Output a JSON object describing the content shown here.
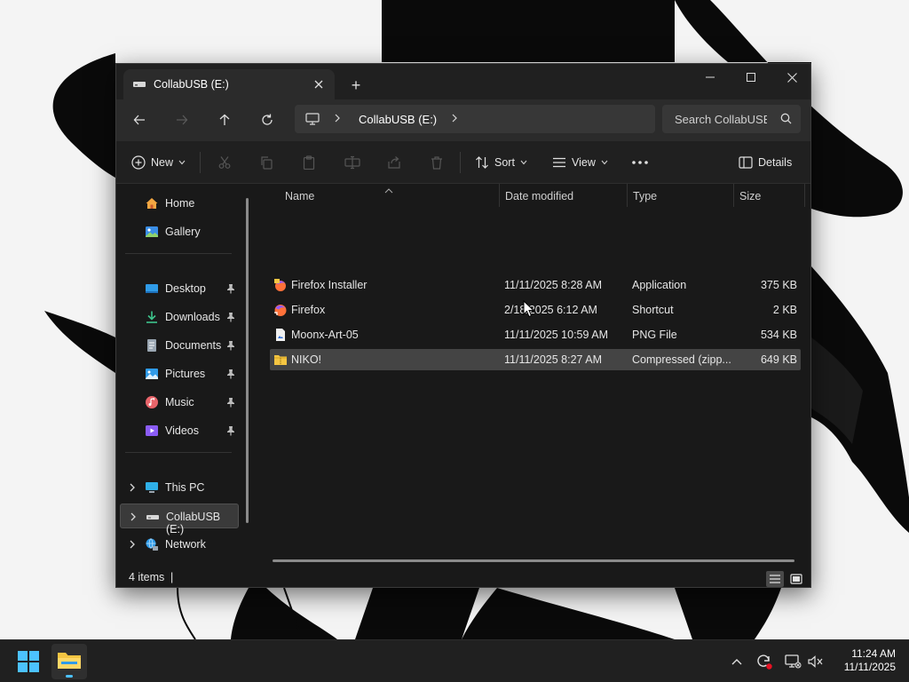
{
  "window": {
    "tab_title": "CollabUSB (E:)",
    "new_tab": "+"
  },
  "address": {
    "crumb": "CollabUSB (E:)",
    "search_placeholder": "Search CollabUSB (E:)"
  },
  "toolbar": {
    "new_label": "New",
    "sort_label": "Sort",
    "view_label": "View",
    "details_label": "Details"
  },
  "sidebar": {
    "items": [
      {
        "label": "Home",
        "icon": "home-icon"
      },
      {
        "label": "Gallery",
        "icon": "gallery-icon"
      },
      {
        "label": "Desktop",
        "icon": "desktop-icon"
      },
      {
        "label": "Downloads",
        "icon": "downloads-icon"
      },
      {
        "label": "Documents",
        "icon": "documents-icon"
      },
      {
        "label": "Pictures",
        "icon": "pictures-icon"
      },
      {
        "label": "Music",
        "icon": "music-icon"
      },
      {
        "label": "Videos",
        "icon": "videos-icon"
      },
      {
        "label": "This PC",
        "icon": "this-pc-icon"
      },
      {
        "label": "CollabUSB (E:)",
        "icon": "usb-drive-icon"
      },
      {
        "label": "Network",
        "icon": "network-icon"
      }
    ]
  },
  "columns": {
    "name": "Name",
    "date": "Date modified",
    "type": "Type",
    "size": "Size"
  },
  "files": [
    {
      "name": "Firefox Installer",
      "date": "11/11/2025 8:28 AM",
      "type": "Application",
      "size": "375 KB",
      "icon": "firefox-installer-icon"
    },
    {
      "name": "Firefox",
      "date": "2/18/2025 6:12 AM",
      "type": "Shortcut",
      "size": "2 KB",
      "icon": "firefox-icon"
    },
    {
      "name": "Moonx-Art-05",
      "date": "11/11/2025 10:59 AM",
      "type": "PNG File",
      "size": "534 KB",
      "icon": "png-file-icon"
    },
    {
      "name": "NIKO!",
      "date": "11/11/2025 8:27 AM",
      "type": "Compressed (zipp...",
      "size": "649 KB",
      "icon": "zip-folder-icon"
    }
  ],
  "status": {
    "count": "4 items",
    "caret": "|"
  },
  "clock": {
    "time": "11:24 AM",
    "date": "11/11/2025"
  },
  "colors": {
    "window_bg": "#191919",
    "selected_row": "#444444",
    "accent": "#4cc2ff"
  }
}
